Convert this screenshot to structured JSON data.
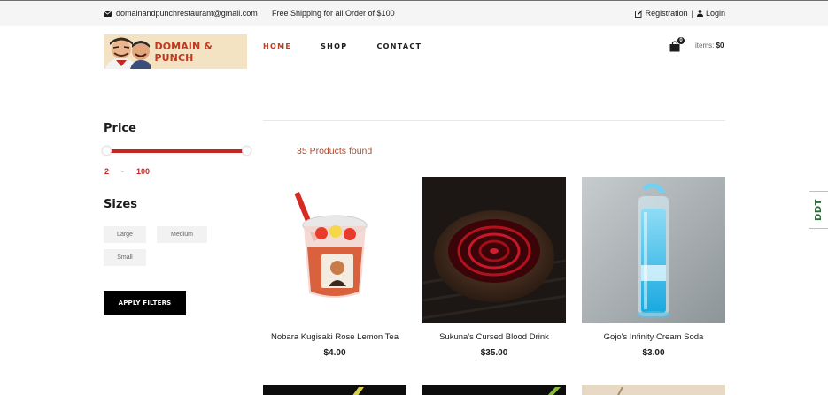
{
  "topbar": {
    "email": "domainandpunchrestaurant@gmail.com",
    "shipping": "Free Shipping for all Order of $100",
    "registration": "Registration",
    "separator": "|",
    "login": "Login"
  },
  "header": {
    "logo_text": "DOMAIN & PUNCH",
    "nav": [
      {
        "label": "HOME",
        "active": true
      },
      {
        "label": "SHOP",
        "active": false
      },
      {
        "label": "CONTACT",
        "active": false
      }
    ],
    "cart_count": "0",
    "cart_items_label": "items:",
    "cart_total": "$0"
  },
  "sidebar": {
    "price_heading": "Price",
    "price_min": "2",
    "price_dash": "-",
    "price_max": "100",
    "sizes_heading": "Sizes",
    "sizes": [
      "Large",
      "Medium",
      "Small"
    ],
    "apply_label": "APPLY FILTERS"
  },
  "main": {
    "products_found": "35 Products found",
    "products": [
      {
        "name": "Nobara Kugisaki Rose Lemon Tea",
        "price": "$4.00"
      },
      {
        "name": "Sukuna's Cursed Blood Drink",
        "price": "$35.00"
      },
      {
        "name": "Gojo's Infinity Cream Soda",
        "price": "$3.00"
      }
    ]
  },
  "side_badge": "DDT",
  "colors": {
    "accent": "#c4271f",
    "brand": "#b34227",
    "topbar_bg": "#f5f5f5"
  }
}
